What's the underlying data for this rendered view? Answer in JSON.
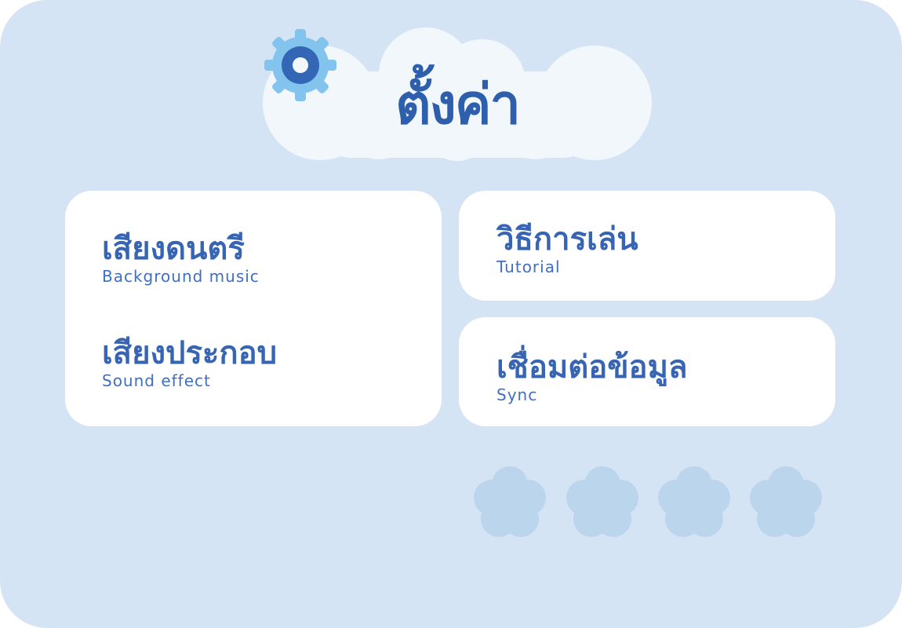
{
  "settings": {
    "title": "ตั้งค่า",
    "title_icon": "gear-icon",
    "menu": {
      "music": {
        "label_th": "เสียงดนตรี",
        "label_en": "Background music"
      },
      "sound_effect": {
        "label_th": "เสียงประกอบ",
        "label_en": "Sound effect"
      },
      "tutorial": {
        "label_th": "วิธีการเล่น",
        "label_en": "Tutorial"
      },
      "sync": {
        "label_th": "เชื่อมต่อข้อมูล",
        "label_en": "Sync"
      }
    },
    "decoration": {
      "flower_icon": "flower-icon",
      "count": 4
    }
  },
  "colors": {
    "panel_bg": "#d5e4f4",
    "card_bg": "#ffffff",
    "text_primary": "#2e5fad",
    "gear_outer": "#82c4ee",
    "gear_inner": "#3366b5",
    "cloud": "#f2f7fc",
    "flower": "#bbd5ec"
  }
}
